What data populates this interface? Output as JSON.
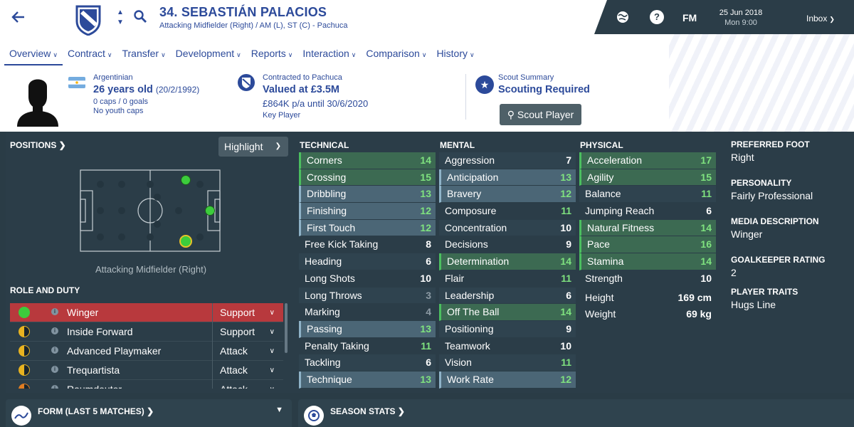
{
  "header": {
    "player_name": "34. SEBASTIÁN PALACIOS",
    "player_sub": "Attacking Midfielder (Right) / AM (L), ST (C) - Pachuca",
    "fm_label": "FM",
    "date": "25 Jun 2018",
    "time": "Mon 9:00",
    "inbox": "Inbox"
  },
  "tabs": [
    {
      "label": "Overview",
      "active": true
    },
    {
      "label": "Contract"
    },
    {
      "label": "Transfer"
    },
    {
      "label": "Development"
    },
    {
      "label": "Reports"
    },
    {
      "label": "Interaction"
    },
    {
      "label": "Comparison"
    },
    {
      "label": "History"
    }
  ],
  "summary": {
    "nationality": "Argentinian",
    "age": "26 years old",
    "dob": "(20/2/1992)",
    "caps": "0 caps / 0 goals",
    "youth_caps": "No youth caps",
    "contract_label": "Contracted to Pachuca",
    "value": "Valued at £3.5M",
    "wage": "£864K p/a until 30/6/2020",
    "squad_status": "Key Player",
    "scout_label": "Scout Summary",
    "scout_status": "Scouting Required",
    "scout_button": "Scout Player"
  },
  "positions": {
    "title": "POSITIONS",
    "highlight_label": "Highlight",
    "pitch_label": "Attacking Midfielder (Right)"
  },
  "roles": {
    "title": "ROLE AND DUTY",
    "items": [
      {
        "name": "Winger",
        "duty": "Support",
        "selected": true,
        "rating": "full"
      },
      {
        "name": "Inside Forward",
        "duty": "Support",
        "rating": "half"
      },
      {
        "name": "Advanced Playmaker",
        "duty": "Attack",
        "rating": "half"
      },
      {
        "name": "Trequartista",
        "duty": "Attack",
        "rating": "half"
      },
      {
        "name": "Raumdeuter",
        "duty": "Attack",
        "rating": "half-orange"
      }
    ]
  },
  "attributes": {
    "technical": {
      "title": "TECHNICAL",
      "rows": [
        {
          "name": "Corners",
          "value": "14"
        },
        {
          "name": "Crossing",
          "value": "15"
        },
        {
          "name": "Dribbling",
          "value": "13"
        },
        {
          "name": "Finishing",
          "value": "12"
        },
        {
          "name": "First Touch",
          "value": "12"
        },
        {
          "name": "Free Kick Taking",
          "value": "8"
        },
        {
          "name": "Heading",
          "value": "6"
        },
        {
          "name": "Long Shots",
          "value": "10"
        },
        {
          "name": "Long Throws",
          "value": "3"
        },
        {
          "name": "Marking",
          "value": "4"
        },
        {
          "name": "Passing",
          "value": "13"
        },
        {
          "name": "Penalty Taking",
          "value": "11"
        },
        {
          "name": "Tackling",
          "value": "6"
        },
        {
          "name": "Technique",
          "value": "13"
        }
      ]
    },
    "mental": {
      "title": "MENTAL",
      "rows": [
        {
          "name": "Aggression",
          "value": "7"
        },
        {
          "name": "Anticipation",
          "value": "13"
        },
        {
          "name": "Bravery",
          "value": "12"
        },
        {
          "name": "Composure",
          "value": "11"
        },
        {
          "name": "Concentration",
          "value": "10"
        },
        {
          "name": "Decisions",
          "value": "9"
        },
        {
          "name": "Determination",
          "value": "14"
        },
        {
          "name": "Flair",
          "value": "11"
        },
        {
          "name": "Leadership",
          "value": "6"
        },
        {
          "name": "Off The Ball",
          "value": "14"
        },
        {
          "name": "Positioning",
          "value": "9"
        },
        {
          "name": "Teamwork",
          "value": "10"
        },
        {
          "name": "Vision",
          "value": "11"
        },
        {
          "name": "Work Rate",
          "value": "12"
        }
      ]
    },
    "physical": {
      "title": "PHYSICAL",
      "rows": [
        {
          "name": "Acceleration",
          "value": "17"
        },
        {
          "name": "Agility",
          "value": "15"
        },
        {
          "name": "Balance",
          "value": "11"
        },
        {
          "name": "Jumping Reach",
          "value": "6"
        },
        {
          "name": "Natural Fitness",
          "value": "14"
        },
        {
          "name": "Pace",
          "value": "16"
        },
        {
          "name": "Stamina",
          "value": "14"
        },
        {
          "name": "Strength",
          "value": "10"
        }
      ],
      "height_label": "Height",
      "height": "169 cm",
      "weight_label": "Weight",
      "weight": "69 kg"
    }
  },
  "details": {
    "preferred_foot_label": "PREFERRED FOOT",
    "preferred_foot": "Right",
    "personality_label": "PERSONALITY",
    "personality": "Fairly Professional",
    "media_label": "MEDIA DESCRIPTION",
    "media": "Winger",
    "gk_label": "GOALKEEPER RATING",
    "gk": "2",
    "traits_label": "PLAYER TRAITS",
    "traits": "Hugs Line"
  },
  "bottom": {
    "form_title": "FORM (LAST 5 MATCHES)",
    "season_title": "SEASON STATS"
  },
  "colors": {
    "brand_blue": "#2c4a9a",
    "panel_dark": "#2b3d48",
    "highlight_green": "#3c6a52",
    "highlight_blue": "#4b6676",
    "selected_red": "#b8393d"
  }
}
